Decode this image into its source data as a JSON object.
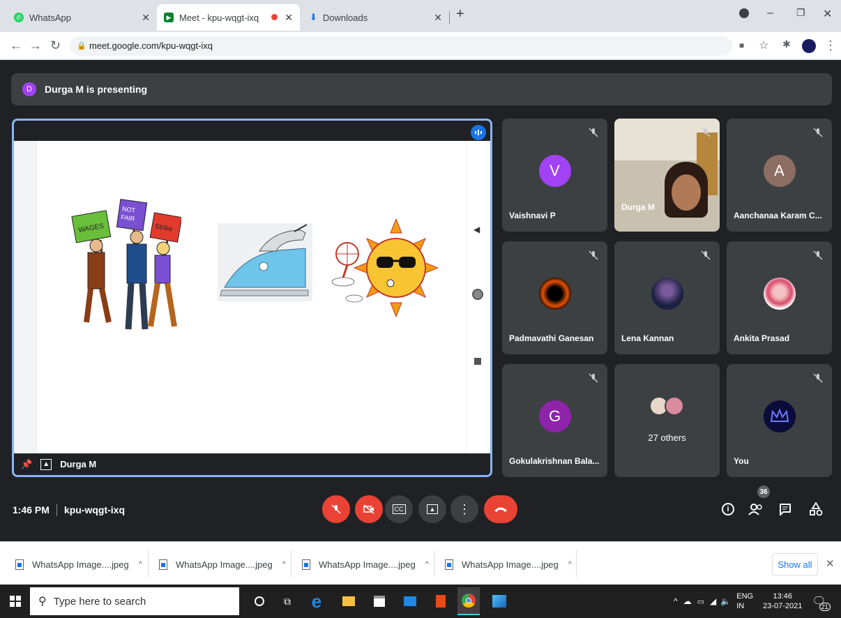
{
  "browser": {
    "tabs": [
      {
        "label": "WhatsApp",
        "icon": "whatsapp-icon",
        "color": "#25d366"
      },
      {
        "label": "Meet - kpu-wqgt-ixq",
        "icon": "meet-icon",
        "color": "#00832d"
      },
      {
        "label": "Downloads",
        "icon": "download-icon",
        "color": "#1a73e8"
      }
    ],
    "url": "meet.google.com/kpu-wqgt-ixq"
  },
  "meet": {
    "presenting_initial": "D",
    "presenting_text": "Durga M is presenting",
    "stage_name": "Durga M",
    "tiles": [
      {
        "name": "Vaishnavi P",
        "initial": "V",
        "color": "#a142f4"
      },
      {
        "name": "Durga M",
        "initial": "",
        "color": ""
      },
      {
        "name": "Aanchanaa Karam C...",
        "initial": "A",
        "color": "#8d6e63"
      },
      {
        "name": "Padmavathi Ganesan",
        "initial": "",
        "color": ""
      },
      {
        "name": "Lena Kannan",
        "initial": "",
        "color": ""
      },
      {
        "name": "Ankita Prasad",
        "initial": "",
        "color": ""
      },
      {
        "name": "Gokulakrishnan Bala...",
        "initial": "G",
        "color": "#8e24aa"
      },
      {
        "name": "27 others",
        "initial": "",
        "color": ""
      },
      {
        "name": "You",
        "initial": "",
        "color": ""
      }
    ],
    "time": "1:46 PM",
    "code": "kpu-wqgt-ixq",
    "participants_count": "36"
  },
  "downloads": {
    "items": [
      "WhatsApp Image....jpeg",
      "WhatsApp Image....jpeg",
      "WhatsApp Image....jpeg",
      "WhatsApp Image....jpeg"
    ],
    "show_all": "Show all"
  },
  "taskbar": {
    "search_placeholder": "Type here to search",
    "lang": "ENG",
    "region": "IN",
    "time": "13:46",
    "date": "23-07-2021",
    "notifications": "21"
  }
}
